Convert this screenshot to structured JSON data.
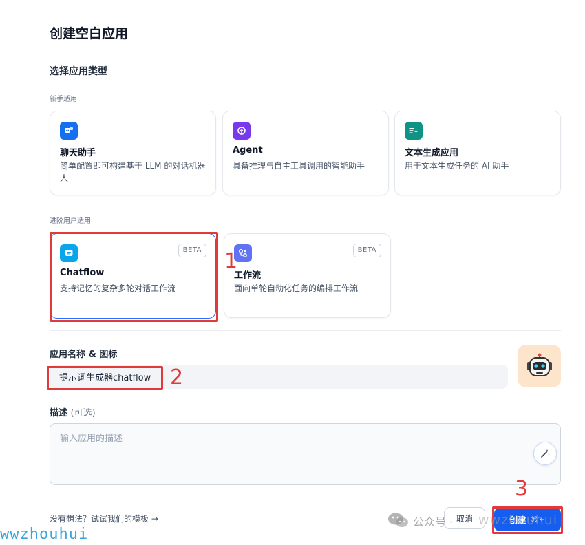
{
  "dialog": {
    "title": "创建空白应用",
    "type_section_label": "选择应用类型",
    "beginner_group_label": "新手适用",
    "advanced_group_label": "进阶用户适用"
  },
  "app_types": {
    "chatbot": {
      "name": "聊天助手",
      "desc": "简单配置即可构建基于 LLM 的对话机器人",
      "icon": "chat-bot-icon",
      "color": "#1570ef"
    },
    "agent": {
      "name": "Agent",
      "desc": "具备推理与自主工具调用的智能助手",
      "icon": "agent-brain-icon",
      "color": "#7839ee"
    },
    "completion": {
      "name": "文本生成应用",
      "desc": "用于文本生成任务的 AI 助手",
      "icon": "text-generation-icon",
      "color": "#0e9384"
    },
    "chatflow": {
      "name": "Chatflow",
      "desc": "支持记忆的复杂多轮对话工作流",
      "badge": "BETA",
      "icon": "chatflow-icon",
      "color": "#0ba5ec",
      "selected": true
    },
    "workflow": {
      "name": "工作流",
      "desc": "面向单轮自动化任务的编排工作流",
      "badge": "BETA",
      "icon": "workflow-icon",
      "color": "#6172f3"
    }
  },
  "form": {
    "name_label": "应用名称 & 图标",
    "name_value": "提示词生成器chatflow",
    "avatar_icon": "robot-avatar-icon",
    "desc_label": "描述",
    "desc_optional": "(可选)",
    "desc_placeholder": "输入应用的描述"
  },
  "footer": {
    "template_link": "没有想法？试试我们的模板 →",
    "cancel_label": "取消",
    "create_label": "创建",
    "create_shortcut": "⌘ ↵"
  },
  "annotations": [
    "1",
    "2",
    "3"
  ],
  "watermark": {
    "wechat_text": "公众号 ·",
    "site_text": "wwzhouhui",
    "left_text": "wwzhouhui"
  }
}
